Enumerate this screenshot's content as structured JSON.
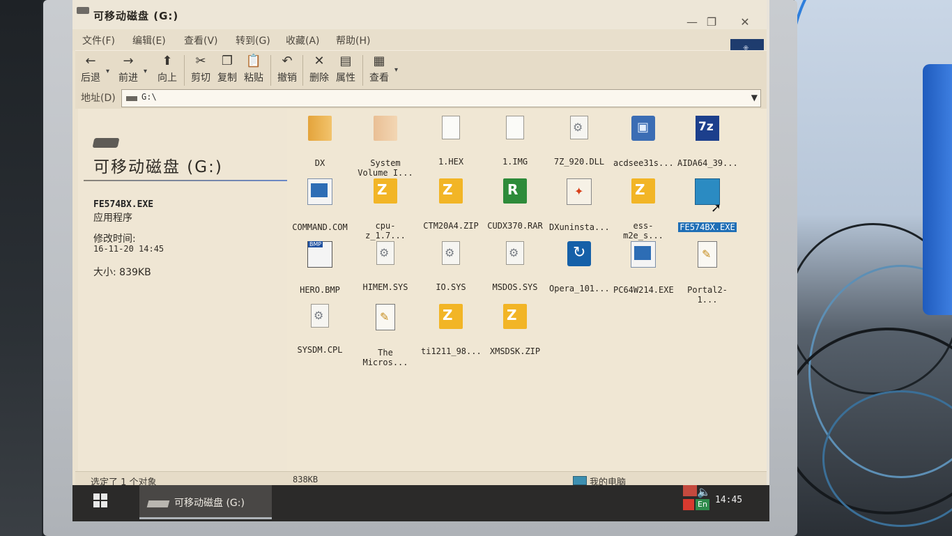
{
  "window": {
    "title": "可移动磁盘  (G:)",
    "controls": {
      "minimize": "—",
      "maximize": "❐",
      "close": "✕"
    }
  },
  "menu": {
    "items": [
      "文件(F)",
      "编辑(E)",
      "查看(V)",
      "转到(G)",
      "收藏(A)",
      "帮助(H)"
    ]
  },
  "toolbar": {
    "back": "后退",
    "forward": "前进",
    "up": "向上",
    "cut": "剪切",
    "copy": "复制",
    "paste": "粘贴",
    "undo": "撤销",
    "delete": "删除",
    "properties": "属性",
    "view": "查看"
  },
  "address": {
    "label": "地址(D)",
    "value": "G:\\"
  },
  "info": {
    "drive_title": "可移动磁盘 (G:)",
    "file_name": "FE574BX.EXE",
    "file_type": "应用程序",
    "modified_label": "修改时间:",
    "modified_value": "16-11-20 14:45",
    "size": "大小: 839KB"
  },
  "files": [
    {
      "name": "DX",
      "icon": "folder-icon"
    },
    {
      "name": "System Volume I...",
      "icon": "folder-icon"
    },
    {
      "name": "1.HEX",
      "icon": "document-icon"
    },
    {
      "name": "1.IMG",
      "icon": "document-icon"
    },
    {
      "name": "7Z_920.DLL",
      "icon": "dll-gear-icon"
    },
    {
      "name": "acdsee31s...",
      "icon": "installer-icon"
    },
    {
      "name": "AIDA64_39...",
      "icon": "7z-archive-icon"
    },
    {
      "name": "COMMAND.COM",
      "icon": "program-icon"
    },
    {
      "name": "cpu-z_1.7...",
      "icon": "zip-archive-icon"
    },
    {
      "name": "CTM20A4.ZIP",
      "icon": "zip-archive-icon"
    },
    {
      "name": "CUDX370.RAR",
      "icon": "rar-archive-icon"
    },
    {
      "name": "DXuninsta...",
      "icon": "uninstaller-icon"
    },
    {
      "name": "ess-m2e_s...",
      "icon": "zip-archive-icon"
    },
    {
      "name": "FE574BX.EXE",
      "icon": "program-icon",
      "selected": true
    },
    {
      "name": "HERO.BMP",
      "icon": "bitmap-icon"
    },
    {
      "name": "HIMEM.SYS",
      "icon": "system-file-icon"
    },
    {
      "name": "IO.SYS",
      "icon": "system-file-icon"
    },
    {
      "name": "MSDOS.SYS",
      "icon": "system-file-icon"
    },
    {
      "name": "Opera_101...",
      "icon": "opera-installer-icon"
    },
    {
      "name": "PC64W214.EXE",
      "icon": "program-icon"
    },
    {
      "name": "Portal2-1...",
      "icon": "text-document-icon"
    },
    {
      "name": "SYSDM.CPL",
      "icon": "system-file-icon"
    },
    {
      "name": "The Micros...",
      "icon": "text-document-icon"
    },
    {
      "name": "ti1211_98...",
      "icon": "zip-archive-icon"
    },
    {
      "name": "XMSDSK.ZIP",
      "icon": "zip-archive-icon"
    }
  ],
  "status": {
    "selection": "选定了 1 个对象",
    "size": "838KB",
    "location": "我的电脑"
  },
  "taskbar": {
    "task_label": "可移动磁盘 (G:)",
    "lang": "En",
    "clock": "14:45"
  },
  "colors": {
    "window_bg": "#ebe2cf",
    "selection": "#1f6fb6",
    "taskbar": "#2b2a29"
  }
}
